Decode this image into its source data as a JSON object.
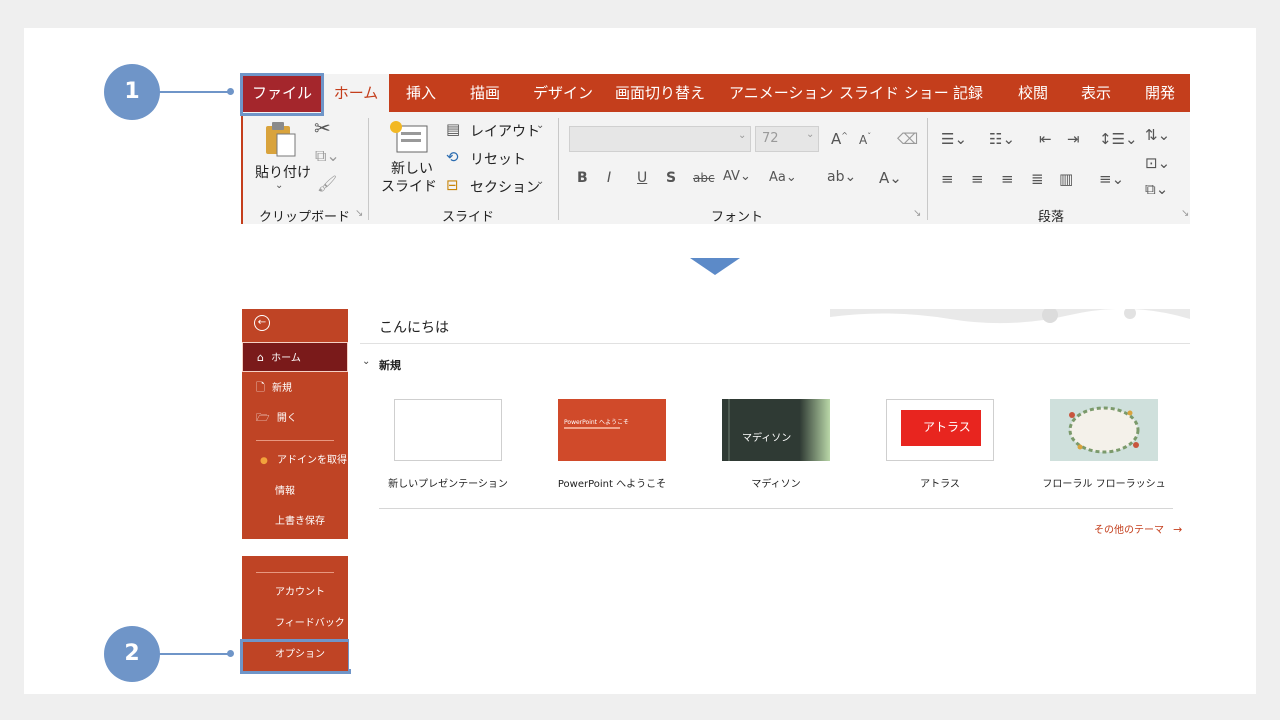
{
  "ribbon": {
    "tabs": {
      "file": "ファイル",
      "home": "ホーム",
      "insert": "挿入",
      "draw": "描画",
      "design": "デザイン",
      "transitions": "画面切り替え",
      "animations": "アニメーション",
      "slideshow": "スライド ショー",
      "record": "記録",
      "review": "校閲",
      "view": "表示",
      "developer": "開発"
    },
    "clipboard": {
      "paste": "貼り付け",
      "label": "クリップボード"
    },
    "slides": {
      "new_slide_line1": "新しい",
      "new_slide_line2": "スライド",
      "layout": "レイアウト",
      "reset": "リセット",
      "section": "セクション",
      "label": "スライド"
    },
    "font": {
      "size": "72",
      "label": "フォント"
    },
    "paragraph": {
      "label": "段落"
    }
  },
  "backstage": {
    "nav": {
      "home": "ホーム",
      "new": "新規",
      "open": "開く",
      "addins": "アドインを取得",
      "info": "情報",
      "save": "上書き保存",
      "account": "アカウント",
      "feedback": "フィードバック",
      "options": "オプション"
    },
    "greeting": "こんにちは",
    "new_section": "新規",
    "templates": [
      {
        "name": "新しいプレゼンテーション"
      },
      {
        "name": "PowerPoint へようこそ",
        "thumb_title": "PowerPoint へようこそ"
      },
      {
        "name": "マディソン",
        "thumb_title": "マディソン"
      },
      {
        "name": "アトラス",
        "thumb_title": "アトラス"
      },
      {
        "name": "フローラル フローラッシュ"
      }
    ],
    "more_themes": "その他のテーマ"
  },
  "callouts": {
    "step1": "1",
    "step2": "2"
  },
  "colors": {
    "ppt_red": "#c43e1c",
    "file_tab": "#a4262c",
    "backstage_nav": "#bf4425",
    "callout_blue": "#6f95c8"
  }
}
